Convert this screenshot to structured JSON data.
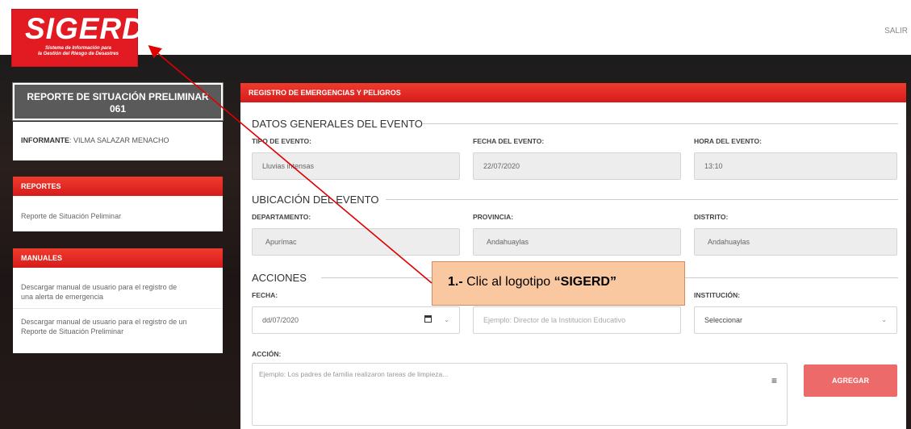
{
  "header": {
    "logo_title": "SIGERD",
    "logo_subtitle_1": "Sistema de Información para",
    "logo_subtitle_2": "la Gestión del Riesgo de Desastres",
    "logout_label": "SALIR"
  },
  "sidebar": {
    "report_title_1": "REPORTE DE SITUACIÓN PRELIMINAR",
    "report_title_2": "061",
    "informante_label": "INFORMANTE",
    "informante_value": ": VILMA SALAZAR MENACHO",
    "reportes": {
      "title": "REPORTES",
      "items": [
        "Reporte de Situación Peliminar"
      ]
    },
    "manuales": {
      "title": "MANUALES",
      "items": [
        "Descargar manual de usuario para el registro de una alerta de emergencia",
        "Descargar manual de usuario para el registro de un Reporte de Situación Preliminar"
      ]
    }
  },
  "main": {
    "panel_title": "REGISTRO DE EMERGENCIAS Y PELIGROS",
    "datos_generales": {
      "title": "DATOS GENERALES DEL EVENTO",
      "tipo_label": "TIPO DE EVENTO:",
      "tipo_value": "Lluvias intensas",
      "fecha_label": "FECHA DEL EVENTO:",
      "fecha_value": "22/07/2020",
      "hora_label": "HORA DEL EVENTO:",
      "hora_value": "13:10"
    },
    "ubicacion": {
      "title": "UBICACIÓN DEL EVENTO",
      "departamento_label": "DEPARTAMENTO:",
      "departamento_value": "Apurímac",
      "provincia_label": "PROVINCIA:",
      "provincia_value": "Andahuaylas",
      "distrito_label": "DISTRITO:",
      "distrito_value": "Andahuaylas"
    },
    "acciones": {
      "title": "ACCIONES",
      "fecha_label": "FECHA:",
      "fecha_value": "dd/07/2020",
      "responsable_placeholder": "Ejemplo: Director de la Institucion Educativo",
      "institucion_label": "INSTITUCIÓN:",
      "institucion_value": "Seleccionar",
      "accion_label": "ACCIÓN:",
      "accion_placeholder": "Ejemplo: Los padres de familia realizaron tareas de limpieza...",
      "add_button": "AGREGAR"
    }
  },
  "annotation": {
    "step": "1.-",
    "text": "Clic al logotipo",
    "target": "“SIGERD”"
  },
  "colors": {
    "brand_red": "#e21b22",
    "header_red": "#d61c1c",
    "button_pink": "#ec6a6a",
    "callout_fill": "#f9c8a0",
    "arrow": "#e00000"
  }
}
